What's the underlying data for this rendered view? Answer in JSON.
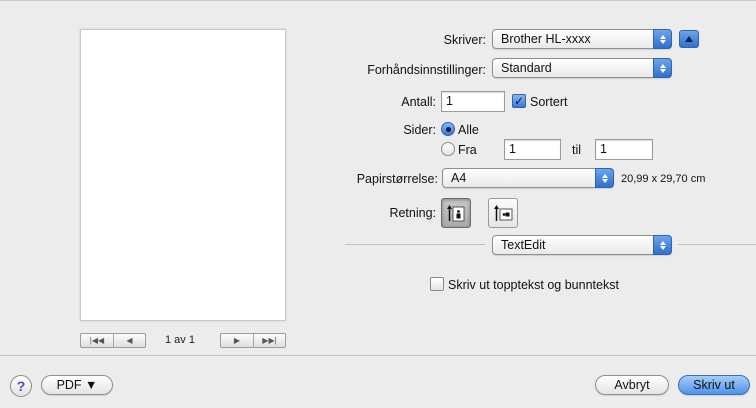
{
  "preview": {
    "page_indicator": "1 av 1",
    "nav_first": "|◀◀",
    "nav_prev": "◀",
    "nav_next": "▶",
    "nav_last": "▶▶|"
  },
  "printer": {
    "label": "Skriver:",
    "value": "Brother HL-xxxx"
  },
  "presets": {
    "label": "Forhåndsinnstillinger:",
    "value": "Standard"
  },
  "copies": {
    "label": "Antall:",
    "value": "1",
    "collate_label": "Sortert",
    "collate_checked": true
  },
  "pages": {
    "label": "Sider:",
    "all_label": "Alle",
    "from_label": "Fra",
    "from_value": "1",
    "to_label": "til",
    "to_value": "1",
    "selected": "all"
  },
  "paper_size": {
    "label": "Papirstørrelse:",
    "value": "A4",
    "dimensions": "20,99 x 29,70 cm"
  },
  "orientation": {
    "label": "Retning:",
    "selected": "portrait"
  },
  "app_section": {
    "value": "TextEdit"
  },
  "header_footer": {
    "label": "Skriv ut topptekst og bunntekst",
    "checked": false
  },
  "footer": {
    "help_symbol": "?",
    "pdf_label": "PDF ▼",
    "cancel_label": "Avbryt",
    "print_label": "Skriv ut"
  },
  "colors": {
    "accent": "#3b78d8",
    "background": "#ececec"
  }
}
